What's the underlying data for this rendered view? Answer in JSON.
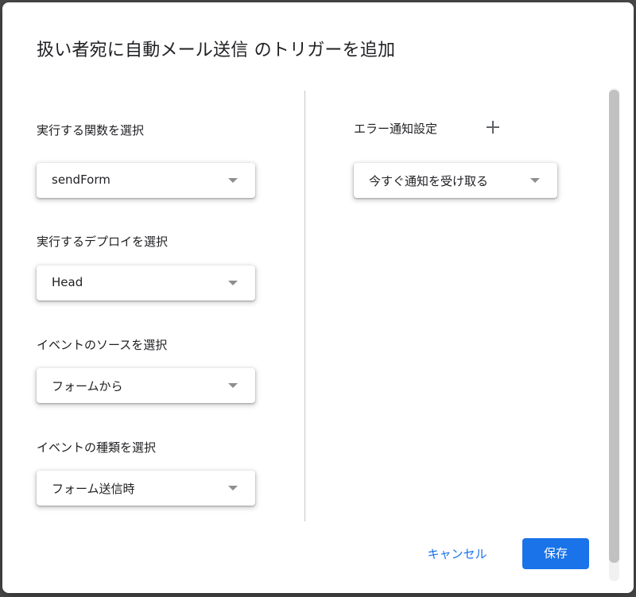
{
  "dialog": {
    "title": "扱い者宛に自動メール送信 のトリガーを追加"
  },
  "left_panel": {
    "function": {
      "label": "実行する関数を選択",
      "value": "sendForm"
    },
    "deployment": {
      "label": "実行するデプロイを選択",
      "value": "Head"
    },
    "event_source": {
      "label": "イベントのソースを選択",
      "value": "フォームから"
    },
    "event_type": {
      "label": "イベントの種類を選択",
      "value": "フォーム送信時"
    }
  },
  "right_panel": {
    "error_notification": {
      "label": "エラー通知設定",
      "add_icon": "plus-icon",
      "value": "今すぐ通知を受け取る"
    }
  },
  "footer": {
    "cancel_label": "キャンセル",
    "save_label": "保存"
  },
  "colors": {
    "accent": "#1a73e8",
    "text": "#202124",
    "divider": "#c8c8c8"
  }
}
